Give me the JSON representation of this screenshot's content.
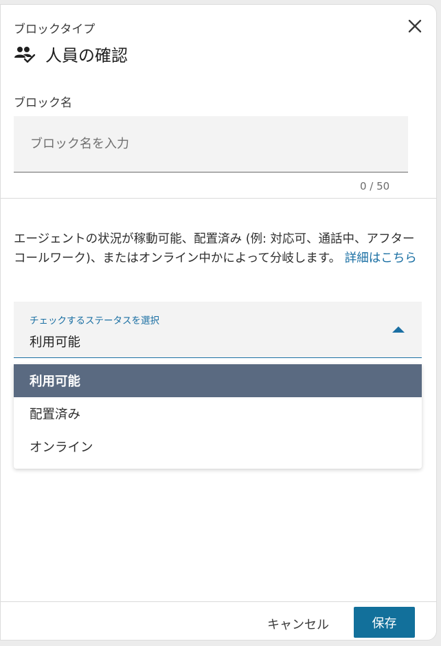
{
  "header": {
    "block_type_label": "ブロックタイプ",
    "title": "人員の確認",
    "title_icon": "people-check-icon",
    "close_icon": "close-icon"
  },
  "block_name": {
    "label": "ブロック名",
    "value": "",
    "placeholder": "ブロック名を入力",
    "counter": "0 / 50"
  },
  "description": {
    "text": "エージェントの状況が稼動可能、配置済み (例: 対応可、通話中、アフターコールワーク)、またはオンライン中かによって分岐します。",
    "link_label": "詳細はこちら"
  },
  "status_select": {
    "label": "チェックするステータスを選択",
    "selected_value": "利用可能",
    "caret_icon": "caret-up-icon",
    "options": [
      {
        "label": "利用可能",
        "selected": true
      },
      {
        "label": "配置済み",
        "selected": false
      },
      {
        "label": "オンライン",
        "selected": false
      }
    ]
  },
  "footer": {
    "cancel_label": "キャンセル",
    "save_label": "保存"
  },
  "colors": {
    "accent": "#1a6fa3",
    "primary_button": "#12709b",
    "selected_option_bg": "#5a6a81"
  }
}
